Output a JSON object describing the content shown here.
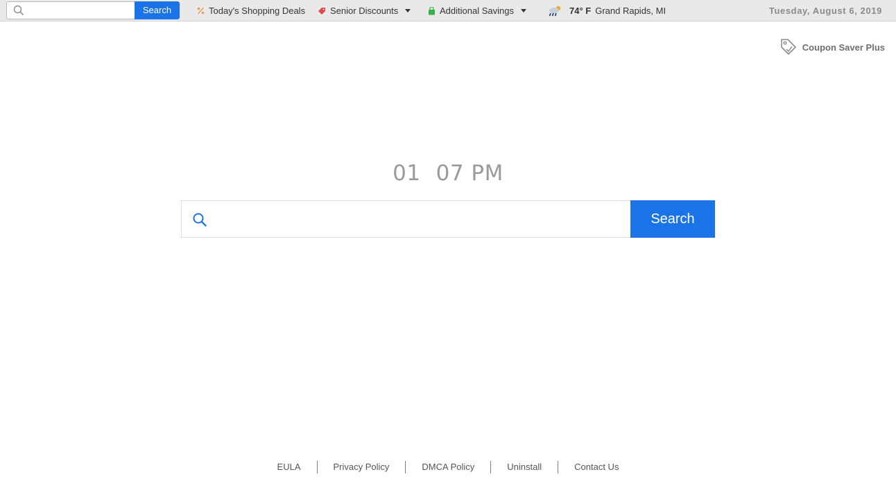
{
  "toolbar": {
    "search": {
      "value": "",
      "button_label": "Search"
    },
    "deals": {
      "label": "Today's Shopping Deals",
      "icon": "percent-icon"
    },
    "senior": {
      "label": "Senior Discounts",
      "icon": "tag-icon"
    },
    "savings": {
      "label": "Additional Savings",
      "icon": "shopping-bag-icon"
    },
    "weather": {
      "temp": "74° F",
      "location": "Grand Rapids, MI",
      "icon": "weather-rain-icon"
    },
    "date": "Tuesday, August 6, 2019"
  },
  "brand": {
    "name": "Coupon Saver Plus",
    "icon": "coupon-tag-icon"
  },
  "clock": {
    "hour": "01",
    "minutes": "07 PM"
  },
  "main_search": {
    "value": "",
    "button_label": "Search"
  },
  "footer": {
    "links": [
      "EULA",
      "Privacy Policy",
      "DMCA Policy",
      "Uninstall",
      "Contact Us"
    ]
  },
  "colors": {
    "accent": "#1a74e8",
    "toolbar_bg": "#e9e9e9",
    "muted_text": "#9a9a9a"
  }
}
